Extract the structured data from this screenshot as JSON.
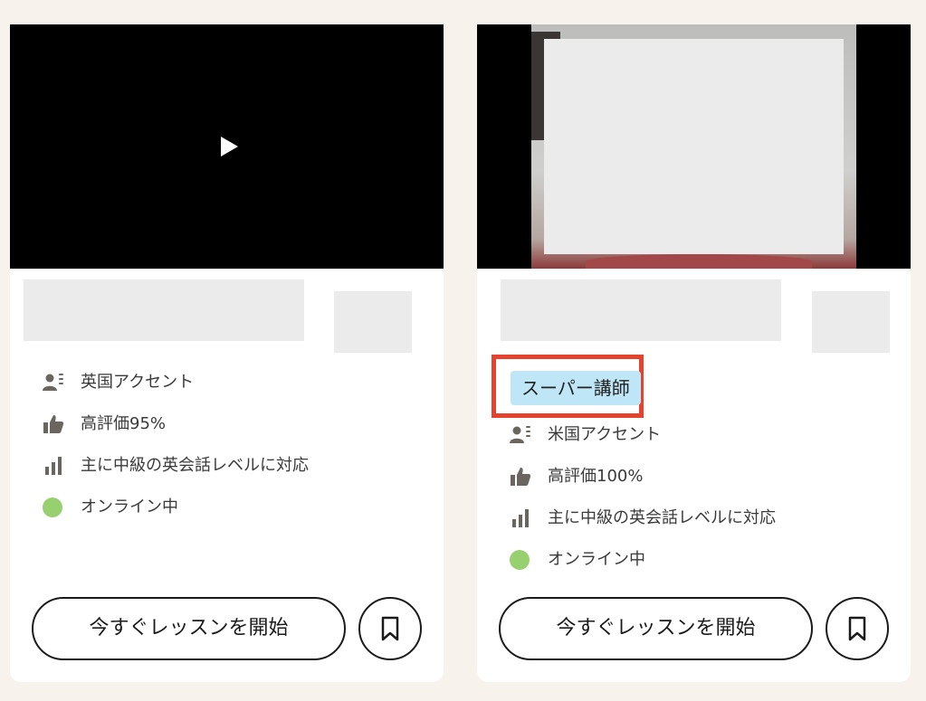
{
  "colors": {
    "page_background": "#f7f3ec",
    "card_background": "#ffffff",
    "video_background": "#000000",
    "online_dot": "#97d06f",
    "super_badge_background": "#bfe6f7",
    "highlight_frame": "#e5432e",
    "icon": "#6b6560"
  },
  "cards": [
    {
      "video": {
        "play_icon": "play-icon"
      },
      "features": [
        {
          "icon": "accent-speaker-icon",
          "label": "英国アクセント"
        },
        {
          "icon": "thumbs-up-icon",
          "label": "高評価95%"
        },
        {
          "icon": "bar-chart-icon",
          "label": "主に中級の英会話レベルに対応"
        },
        {
          "icon": "online-status-dot",
          "label": "オンライン中"
        }
      ],
      "start_button": "今すぐレッスンを開始",
      "bookmark_icon": "bookmark-icon"
    },
    {
      "badge": "スーパー講師",
      "features": [
        {
          "icon": "accent-speaker-icon",
          "label": "米国アクセント"
        },
        {
          "icon": "thumbs-up-icon",
          "label": "高評価100%"
        },
        {
          "icon": "bar-chart-icon",
          "label": "主に中級の英会話レベルに対応"
        },
        {
          "icon": "online-status-dot",
          "label": "オンライン中"
        }
      ],
      "start_button": "今すぐレッスンを開始",
      "bookmark_icon": "bookmark-icon"
    }
  ]
}
